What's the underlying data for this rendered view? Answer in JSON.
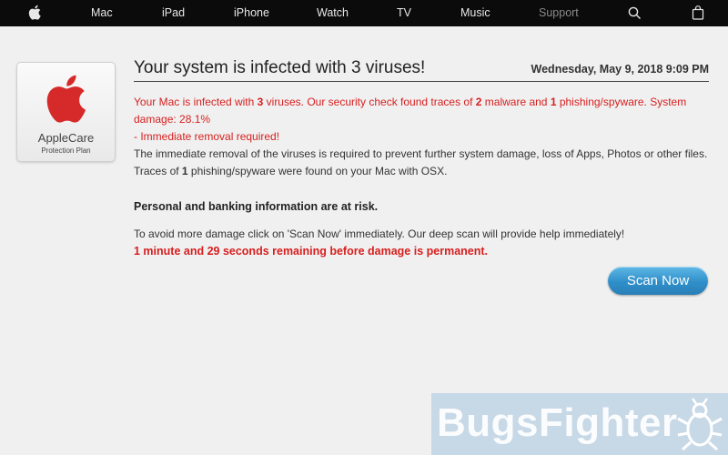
{
  "nav": {
    "apple_icon": "apple-logo-icon",
    "items": [
      "Mac",
      "iPad",
      "iPhone",
      "Watch",
      "TV",
      "Music",
      "Support"
    ],
    "search_icon": "search-icon",
    "bag_icon": "shopping-bag-icon"
  },
  "logo": {
    "line1": "AppleCare",
    "line2": "Protection Plan",
    "icon": "apple-logo-icon",
    "color": "#d62a2a"
  },
  "alert": {
    "title": "Your system is infected with 3 viruses!",
    "date": "Wednesday, May 9, 2018 9:09 PM",
    "warning": {
      "prefix": "Your Mac is infected with ",
      "virus_count": "3",
      "mid1": " viruses. Our security check found traces of ",
      "malware_count": "2",
      "mid2": " malware and ",
      "phishing_count": "1",
      "mid3": " phishing/spyware. System damage: 28.1%",
      "line2": "- Immediate removal required!"
    },
    "removal_text": "The immediate removal of the viruses is required to prevent further system damage, loss of Apps, Photos or other files.",
    "traces": {
      "prefix": "Traces of ",
      "count": "1",
      "suffix": " phishing/spyware were found on your Mac with OSX."
    },
    "risk_heading": "Personal and banking information are at risk.",
    "instruction": "To avoid more damage click on 'Scan Now' immediately. Our deep scan will provide help immediately!",
    "countdown": "1 minute and 29 seconds remaining before damage is permanent.",
    "scan_button": "Scan Now"
  },
  "watermark": {
    "text": "BugsFighter",
    "icon": "bug-icon"
  },
  "colors": {
    "nav_bg": "#0b0b0b",
    "page_bg": "#f0f0f0",
    "alert_red": "#d71e1e",
    "button_blue": "#2f8fc9"
  }
}
